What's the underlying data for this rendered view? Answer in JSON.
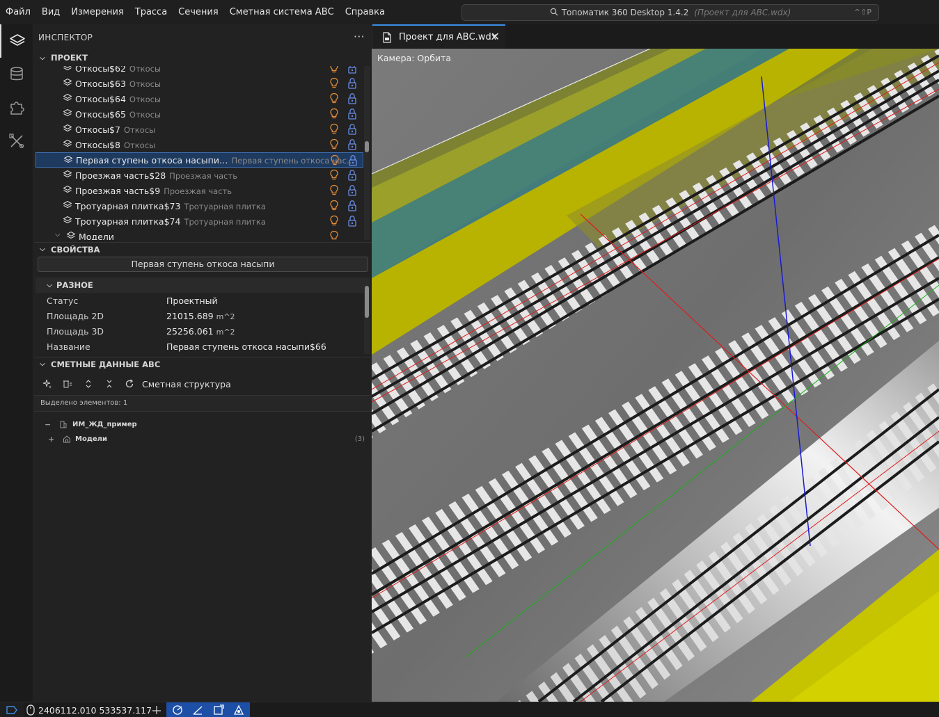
{
  "menubar": {
    "items": [
      "Файл",
      "Вид",
      "Измерения",
      "Трасса",
      "Сечения",
      "Сметная система АВС",
      "Справка"
    ]
  },
  "title_search": {
    "app": "Топоматик 360 Desktop 1.4.2",
    "project": "(Проект для АВС.wdx)",
    "shortcut": "^⇧P"
  },
  "activitybar": {
    "icons": [
      "layers-icon",
      "database-icon",
      "puzzle-icon",
      "tools-icon"
    ]
  },
  "inspector": {
    "title": "ИНСПЕКТОР",
    "more": "···",
    "project_section": "ПРОЕКТ",
    "tree": [
      {
        "name": "Откосы$62",
        "type": "Откосы"
      },
      {
        "name": "Откосы$63",
        "type": "Откосы"
      },
      {
        "name": "Откосы$64",
        "type": "Откосы"
      },
      {
        "name": "Откосы$65",
        "type": "Откосы"
      },
      {
        "name": "Откосы$7",
        "type": "Откосы"
      },
      {
        "name": "Откосы$8",
        "type": "Откосы"
      },
      {
        "name": "Первая ступень откоса насыпи…",
        "type": "Первая ступень откоса нас…",
        "selected": true
      },
      {
        "name": "Проезжая часть$28",
        "type": "Проезжая часть"
      },
      {
        "name": "Проезжая часть$9",
        "type": "Проезжая часть"
      },
      {
        "name": "Тротуарная плитка$73",
        "type": "Тротуарная плитка"
      },
      {
        "name": "Тротуарная плитка$74",
        "type": "Тротуарная плитка"
      }
    ],
    "models_node": "Модели"
  },
  "properties": {
    "section": "СВОЙСТВА",
    "object_name": "Первая ступень откоса насыпи",
    "group": "РАЗНОЕ",
    "rows": [
      {
        "key": "Статус",
        "value": "Проектный",
        "unit": ""
      },
      {
        "key": "Площадь 2D",
        "value": "21015.689",
        "unit": "m^2"
      },
      {
        "key": "Площадь 3D",
        "value": "25256.061",
        "unit": "m^2"
      },
      {
        "key": "Название",
        "value": "Первая ступень откоса насыпи$66",
        "unit": ""
      }
    ]
  },
  "abc": {
    "section": "СМЕТНЫЕ ДАННЫЕ АВС",
    "structure_label": "Сметная структура",
    "selected_count": "Выделено элементов: 1",
    "root": {
      "toggle": "−",
      "name": "ИМ_ЖД_пример"
    },
    "child": {
      "toggle": "+",
      "name": "Модели",
      "count": "(3)"
    }
  },
  "editor": {
    "tab_label": "Проект для АВС.wdx",
    "close": "✕",
    "camera_label": "Камера: Орбита"
  },
  "statusbar": {
    "coords": "2406112.010 533537.117"
  },
  "colors": {
    "accent": "#3c8ee7",
    "status_tools": "#1e4fa6",
    "bulb": "#e08a3c",
    "lock": "#6a8fe8",
    "embankment_yellow": "#c8c300",
    "teal_strip": "#3f7d7e"
  }
}
